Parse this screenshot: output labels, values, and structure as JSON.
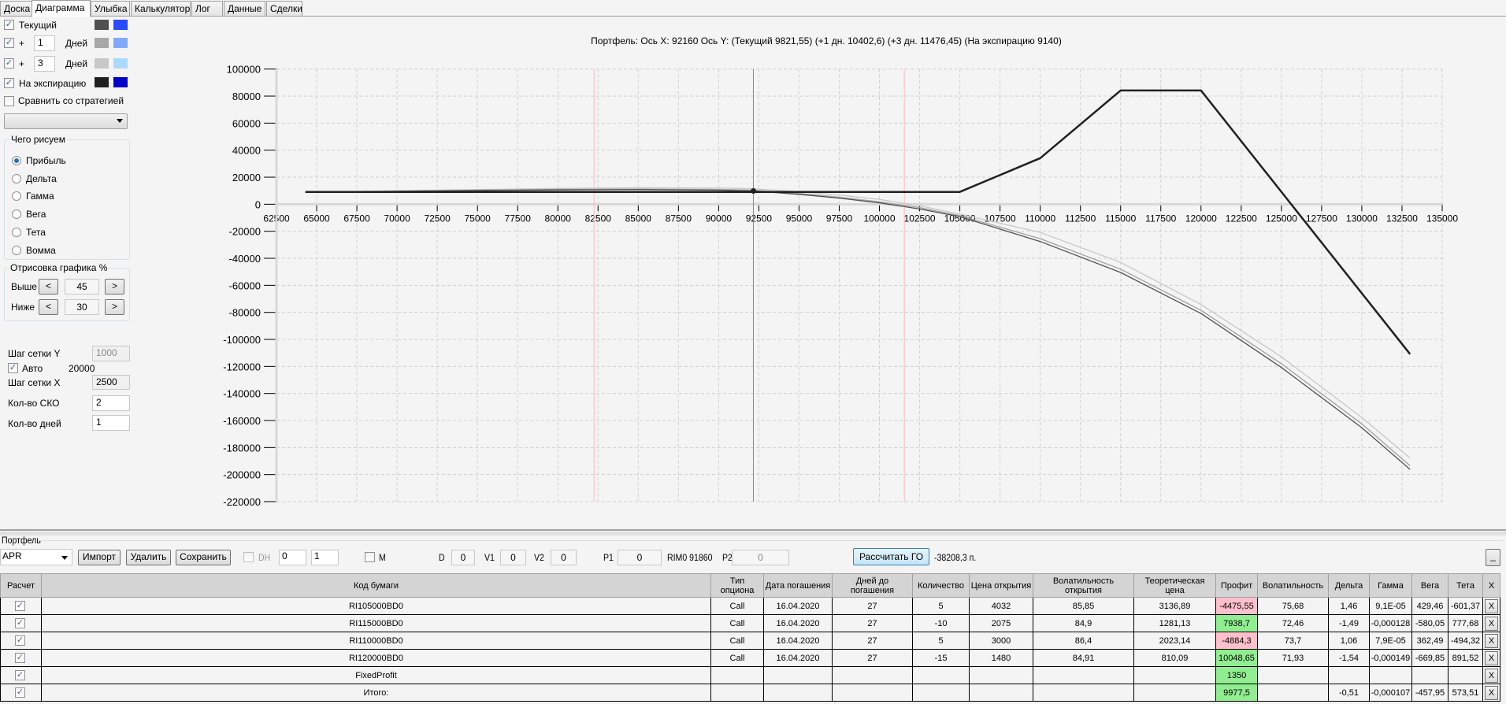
{
  "tabs": [
    "Доска",
    "Диаграмма",
    "Улыбка",
    "Калькулятор",
    "Лог",
    "Данные",
    "Сделки"
  ],
  "active_tab": "Диаграмма",
  "left": {
    "series": [
      {
        "label": "Текущий",
        "checked": true,
        "colors": [
          "#505050",
          "#2a4aff"
        ]
      },
      {
        "label": "Дней",
        "plus": "+",
        "days": "1",
        "checked": true,
        "colors": [
          "#a8a8a8",
          "#80aaff"
        ]
      },
      {
        "label": "Дней",
        "plus": "+",
        "days": "3",
        "checked": true,
        "colors": [
          "#c8c8c8",
          "#aad8ff"
        ]
      },
      {
        "label": "На экспирацию",
        "checked": true,
        "colors": [
          "#202020",
          "#0000c8"
        ]
      }
    ],
    "compare_label": "Сравнить со стратегией",
    "compare_checked": false,
    "strategy_select": "",
    "draw_group": "Чего рисуем",
    "draw_options": [
      "Прибыль",
      "Дельта",
      "Гамма",
      "Вега",
      "Тета",
      "Вомма"
    ],
    "draw_selected": "Прибыль",
    "range_group": "Отрисовка графика %",
    "above_label": "Выше",
    "above_value": "45",
    "below_label": "Ниже",
    "below_value": "30",
    "btn_less": "<",
    "btn_more": ">",
    "grid_y_label": "Шаг сетки Y",
    "grid_y_value": "1000",
    "auto_label": "Авто",
    "auto_checked": true,
    "auto_value": "20000",
    "grid_x_label": "Шаг сетки X",
    "grid_x_value": "2500",
    "sko_label": "Кол-во СКО",
    "sko_value": "2",
    "days_label": "Кол-во дней",
    "days_value": "1"
  },
  "chart_data": {
    "type": "line",
    "title": "Портфель: Ось X: 92160 Ось Y:  (Текущий 9821,55)  (+1 дн. 10402,6)  (+3 дн. 11476,45)  (На экспирацию 9140)",
    "xlim": [
      62500,
      135000
    ],
    "ylim": [
      -220000,
      100000
    ],
    "xstep": 2500,
    "ystep": 20000,
    "grid": true,
    "current_x": 92160,
    "sd_lines": [
      82250,
      101550
    ],
    "series": [
      {
        "name": "+3 дн.",
        "color": "#c8c8c8",
        "x": [
          64300,
          70000,
          75000,
          80000,
          85000,
          90000,
          92160,
          95000,
          97500,
          100000,
          102500,
          105000,
          110000,
          115000,
          120000,
          125000,
          130000,
          133000
        ],
        "y": [
          8900,
          10000,
          10900,
          11700,
          12200,
          12000,
          11476,
          9300,
          6800,
          3600,
          -1200,
          -7300,
          -20800,
          -43000,
          -74200,
          -112900,
          -157700,
          -187800
        ]
      },
      {
        "name": "+1 дн.",
        "color": "#a0a0a0",
        "x": [
          64300,
          70000,
          75000,
          80000,
          85000,
          90000,
          92160,
          95000,
          97500,
          100000,
          102500,
          105000,
          110000,
          115000,
          120000,
          125000,
          130000,
          133000
        ],
        "y": [
          8800,
          9700,
          10400,
          11000,
          11300,
          10900,
          10402,
          8000,
          5200,
          1800,
          -2500,
          -8500,
          -25500,
          -48000,
          -78500,
          -118000,
          -162500,
          -193500
        ]
      },
      {
        "name": "Текущий",
        "color": "#505050",
        "x": [
          64300,
          70000,
          75000,
          80000,
          85000,
          90000,
          92160,
          95000,
          97500,
          100000,
          102500,
          105000,
          110000,
          115000,
          120000,
          125000,
          130000,
          133000
        ],
        "y": [
          8800,
          9500,
          10100,
          10600,
          10800,
          10400,
          9821.55,
          7300,
          4500,
          1000,
          -3500,
          -9150,
          -27600,
          -50500,
          -80800,
          -120800,
          -165300,
          -196200
        ]
      },
      {
        "name": "На экспирацию",
        "color": "#202020",
        "x": [
          64300,
          105000,
          110000,
          115000,
          120000,
          133000
        ],
        "y": [
          9140,
          9140,
          34140,
          84140,
          84140,
          -110860
        ]
      }
    ]
  },
  "portfolio": {
    "label": "Портфель",
    "select": "APR",
    "import": "Импорт",
    "delete": "Удалить",
    "save": "Сохранить",
    "dh_label": "DH",
    "dh_checked": false,
    "spin1": "0",
    "spin2": "1",
    "m_label": "M",
    "d_label": "D",
    "d_value": "0",
    "v1_label": "V1",
    "v1_value": "0",
    "v2_label": "V2",
    "v2_value": "0",
    "p1_label": "P1",
    "p1_value": "0",
    "rim_label": "RIM0 91860",
    "p2_label": "P2",
    "p2_value": "0",
    "calc_button": "Рассчитать ГО",
    "margin_value": "-38208,3 п.",
    "minimize": "_"
  },
  "table": {
    "columns": [
      "Расчет",
      "Код бумаги",
      "Тип опциона",
      "Дата погашения",
      "Дней до погашения",
      "Количество",
      "Цена открытия",
      "Волатильность открытия",
      "Теоретическая цена",
      "Профит",
      "Волатильность",
      "Дельта",
      "Гамма",
      "Вега",
      "Тета",
      "X"
    ],
    "rows": [
      {
        "cells": [
          "RI105000BD0",
          "Call",
          "16.04.2020",
          "27",
          "5",
          "4032",
          "85,85",
          "3136,89",
          "-4475,55",
          "75,68",
          "1,46",
          "9,1E-05",
          "429,46",
          "-601,37"
        ],
        "profit_status": "neg"
      },
      {
        "cells": [
          "RI115000BD0",
          "Call",
          "16.04.2020",
          "27",
          "-10",
          "2075",
          "84,9",
          "1281,13",
          "7938,7",
          "72,46",
          "-1,49",
          "-0,000128",
          "-580,05",
          "777,68"
        ],
        "profit_status": "pos"
      },
      {
        "cells": [
          "RI110000BD0",
          "Call",
          "16.04.2020",
          "27",
          "5",
          "3000",
          "86,4",
          "2023,14",
          "-4884,3",
          "73,7",
          "1,06",
          "7,9E-05",
          "362,49",
          "-494,32"
        ],
        "profit_status": "neg"
      },
      {
        "cells": [
          "RI120000BD0",
          "Call",
          "16.04.2020",
          "27",
          "-15",
          "1480",
          "84,91",
          "810,09",
          "10048,65",
          "71,93",
          "-1,54",
          "-0,000149",
          "-669,85",
          "891,52"
        ],
        "profit_status": "pos"
      },
      {
        "cells": [
          "FixedProfit",
          "",
          "",
          "",
          "",
          "",
          "",
          "",
          "1350",
          "",
          "",
          "",
          "",
          ""
        ],
        "profit_status": "pos"
      },
      {
        "cells": [
          "Итого:",
          "",
          "",
          "",
          "",
          "",
          "",
          "",
          "9977,5",
          "",
          "-0,51",
          "-0,000107",
          "-457,95",
          "573,51"
        ],
        "profit_status": "pos"
      }
    ],
    "check_mark": "✓",
    "remove_label": "X"
  }
}
